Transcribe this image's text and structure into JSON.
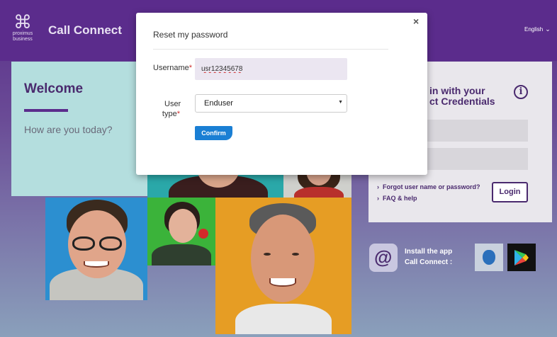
{
  "header": {
    "logo_line1": "proximus",
    "logo_line2": "business",
    "app_title": "Call Connect",
    "language": "English"
  },
  "welcome": {
    "title": "Welcome",
    "subtitle": "How are you today?"
  },
  "login": {
    "title": "in with your\nct Credentials",
    "forgot_link": "Forgot user name or password?",
    "faq_link": "FAQ & help",
    "login_button": "Login"
  },
  "app_promo": {
    "line1": "Install the app",
    "line2": "Call Connect :"
  },
  "modal": {
    "title": "Reset my password",
    "close_symbol": "×",
    "username_label": "Username",
    "username_value": "usr12345678",
    "user_type_label_line1": "User",
    "user_type_label_line2": "type",
    "required_mark": "*",
    "user_type_value": "Enduser",
    "confirm_button": "Confirm"
  },
  "colors": {
    "brand_purple": "#5b2c8c",
    "confirm_blue": "#1a7fd4"
  },
  "icons": [
    "proximus-logo-icon",
    "chevron-down-icon",
    "info-icon",
    "chevron-right-icon",
    "call-connect-app-icon",
    "apple-store-icon",
    "google-play-icon",
    "close-icon",
    "select-caret-icon"
  ]
}
